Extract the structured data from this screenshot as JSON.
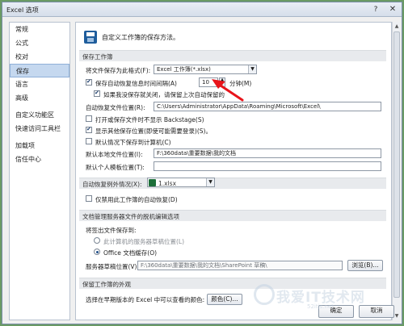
{
  "window": {
    "title": "Excel 选项",
    "help_glyph": "?",
    "close_glyph": "✕"
  },
  "nav": {
    "items": [
      {
        "label": "常规"
      },
      {
        "label": "公式"
      },
      {
        "label": "校对"
      },
      {
        "label": "保存",
        "selected": true
      },
      {
        "label": "语言"
      },
      {
        "label": "高级"
      },
      {
        "label": "自定义功能区"
      },
      {
        "label": "快速访问工具栏"
      },
      {
        "label": "加载项"
      },
      {
        "label": "信任中心"
      }
    ]
  },
  "header": {
    "text": "自定义工作簿的保存方法。"
  },
  "save_workbooks": {
    "section_title": "保存工作簿",
    "format_label": "将文件保存为此格式(F):",
    "format_value": "Excel 工作簿(*.xlsx)",
    "autorecover_label": "保存自动恢复信息时间间隔(A)",
    "autorecover_minutes": "10",
    "minutes_label": "分钟(M)",
    "keep_last_label": "如果我没保存就关闭，请保留上次自动保留的",
    "autorecover_location_label": "自动恢复文件位置(R):",
    "autorecover_location_value": "C:\\Users\\Administrator\\AppData\\Roaming\\Microsoft\\Excel\\",
    "backstage_label": "打开或保存文件时不显示 Backstage(S)",
    "show_additional_label": "显示其他保存位置(即使可能需要登录)(S)。",
    "default_computer_label": "默认情况下保存到计算机(C)",
    "default_local_label": "默认本地文件位置(I):",
    "default_local_value": "F:\\360data\\重要数据\\我的文档",
    "default_template_label": "默认个人模板位置(T):",
    "default_template_value": ""
  },
  "autorecover_exceptions": {
    "label": "自动恢复例外情况(X):",
    "workbook_value": "1.xlsx",
    "disable_label": "仅禁用此工作簿的自动恢复(D)"
  },
  "offline_editing": {
    "section_title": "文档管理服务器文件的脱机编辑选项",
    "save_to_label": "将签出文件保存到:",
    "option_server_label": "此计算机的服务器草稿位置(L)",
    "option_cache_label": "Office 文档缓存(O)",
    "drafts_location_label": "服务器草稿位置(V):",
    "drafts_location_value": "F:\\360data\\重要数据\\我的文档\\SharePoint 草稿\\",
    "browse_label": "浏览(B)..."
  },
  "preserve_visual": {
    "section_title": "保留工作簿的外观",
    "colors_prompt": "选择在早期版本的 Excel 中可以查看的颜色:",
    "colors_button": "颜色(C)..."
  },
  "footer": {
    "ok_label": "确定",
    "cancel_label": "取消"
  },
  "watermark": {
    "text": "我爱IT技术网",
    "url": "52itjs.net"
  },
  "colors": {
    "accent": "#c5d8ef",
    "annotation_arrow": "#e8141b"
  }
}
